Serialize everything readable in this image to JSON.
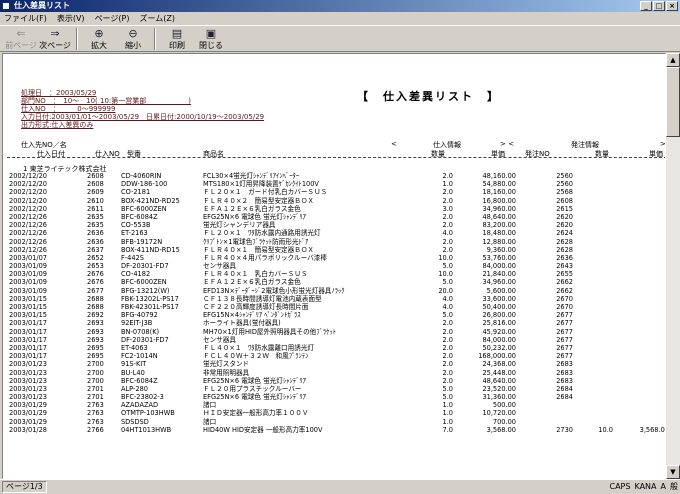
{
  "window": {
    "title": "仕入差異リスト",
    "controls": [
      "_",
      "□",
      "×"
    ]
  },
  "menu": [
    "ファイル(F)",
    "表示(V)",
    "ページ(P)",
    "ズーム(Z)"
  ],
  "toolbar": [
    {
      "label": "前ページ",
      "icon": "prev-page-icon",
      "glyph": "⇐",
      "enabled": false
    },
    {
      "label": "次ページ",
      "icon": "next-page-icon",
      "glyph": "⇒",
      "enabled": true
    },
    {
      "label": "拡大",
      "icon": "zoom-in-icon",
      "glyph": "⊕",
      "enabled": true
    },
    {
      "label": "縮小",
      "icon": "zoom-out-icon",
      "glyph": "⊖",
      "enabled": true
    },
    {
      "label": "印刷",
      "icon": "print-icon",
      "glyph": "▤",
      "enabled": true
    },
    {
      "label": "閉じる",
      "icon": "close-icon",
      "glyph": "▣",
      "enabled": true
    }
  ],
  "report": {
    "title": "【　仕入差異リスト　】",
    "header_lines": [
      "処理日　：2003/05/29",
      "部門NO　：　10～　10( 10:第一営業部　　　　　　)",
      "仕入NO　：　　　0～999999",
      "入力日付:2003/01/01～2003/05/29　日累日付:2000/10/19～2003/05/29",
      "出力形式:仕入差異のみ"
    ],
    "col_head1": {
      "supplier": "仕入先NO／名",
      "lt": "<",
      "purchase_info": "仕入情報",
      "gt_lt": "> <",
      "order_info": "発注情報",
      "gt": ">"
    },
    "col_head2": {
      "date": "仕入日付",
      "no": "仕入NO",
      "code": "型番",
      "name": "商品名",
      "qty": "数量",
      "price": "単価",
      "order_no": "発注NO",
      "order_qty": "数量",
      "order_price": "単価"
    },
    "group": "1 東芝ライテック株式会社",
    "rows": [
      [
        "2002/12/20",
        "2608",
        "CD-4060RIN",
        "FCL30×4蛍光灯ｼｬﾝﾃﾞﾘｱｲﾝﾍﾞｰﾀｰ",
        "2.0",
        "48,160.00",
        "2560",
        "",
        ""
      ],
      [
        "2002/12/20",
        "2608",
        "DDW-186-100",
        "MTS180×1灯用昇降装置ｹﾞｶﾝｸｲﾄ100V",
        "1.0",
        "54,880.00",
        "2560",
        "",
        ""
      ],
      [
        "2002/12/20",
        "2609",
        "CO-2181",
        "ＦＬ２０×１　ガード付乳白カバーＳＵＳ",
        "2.0",
        "18,160.00",
        "2568",
        "",
        ""
      ],
      [
        "2002/12/20",
        "2610",
        "BOX-421ND-RD25",
        "ＦＬＲ４０×２　簡易型安定器ＢＯＸ",
        "2.0",
        "16,800.00",
        "2608",
        "",
        ""
      ],
      [
        "2002/12/20",
        "2611",
        "BFC-6000ZEN",
        "ＥＦＡ１２Ｅ×６乳白ガラス金色",
        "3.0",
        "34,960.00",
        "2615",
        "",
        ""
      ],
      [
        "2002/12/26",
        "2635",
        "BFC-6084Z",
        "EFG25N×6 電球色 蛍光灯ｼｬﾝﾃﾞﾘｱ",
        "2.0",
        "48,640.00",
        "2620",
        "",
        ""
      ],
      [
        "2002/12/26",
        "2635",
        "CO-553B",
        "蛍光灯シャンデリア器具",
        "2.0",
        "83,200.00",
        "2620",
        "",
        ""
      ],
      [
        "2002/12/26",
        "2636",
        "ET-2163",
        "ＦＬ２０×１　ﾜﾀ防水露内通路用誘光灯",
        "4.0",
        "18,480.00",
        "2624",
        "",
        ""
      ],
      [
        "2002/12/26",
        "2636",
        "BFB-19172N",
        "ｸﾘﾌﾟﾄﾝ×1電球色ﾌﾞﾗｹｯﾄ防雨形光ﾄﾞｱ",
        "2.0",
        "12,880.00",
        "2628",
        "",
        ""
      ],
      [
        "2002/12/26",
        "2637",
        "BOX-411ND-RD15",
        "ＦＬＲ４０×１　簡易型安定器ＢＯＸ",
        "2.0",
        "9,360.00",
        "2628",
        "",
        ""
      ],
      [
        "2003/01/07",
        "2652",
        "F-442S",
        "ＦＬＲ４０×４用パラボリックルーバ漆棒",
        "10.0",
        "53,760.00",
        "2636",
        "",
        ""
      ],
      [
        "2003/01/09",
        "2653",
        "DF-20301-FD7",
        "センサ器具",
        "5.0",
        "84,000.00",
        "2643",
        "",
        ""
      ],
      [
        "2003/01/09",
        "2676",
        "CO-4182",
        "ＦＬＲ４０×１　乳白カバーＳＵＳ",
        "10.0",
        "21,840.00",
        "2655",
        "",
        ""
      ],
      [
        "2003/01/09",
        "2676",
        "BFC-6000ZEN",
        "ＥＦＡ１２Ｅ×６乳白ガラス金色",
        "5.0",
        "34,960.00",
        "2662",
        "",
        ""
      ],
      [
        "2003/01/09",
        "2677",
        "BFG-13212(W)",
        "EFD13N×ﾃﾞｰﾀﾞｰｼﾞ2電球色小形蛍光灯器具ﾉﾗｯｸ",
        "20.0",
        "5,600.00",
        "2662",
        "",
        ""
      ],
      [
        "2003/01/15",
        "2688",
        "FBK-13202L-PS17",
        "ＣＦ１３８長時間誘導灯電池内蔵表面型",
        "4.0",
        "33,600.00",
        "2670",
        "",
        ""
      ],
      [
        "2003/01/15",
        "2688",
        "FBK-42301L-PS17",
        "ＣＦ２２０高輝度誘導灯長時間片面",
        "4.0",
        "50,400.00",
        "2670",
        "",
        ""
      ],
      [
        "2003/01/15",
        "2692",
        "BFG-40792",
        "EFG15N×4ｼｬﾝﾃﾞﾘｱ ﾍﾟﾝﾀﾞﾝﾄｶﾞﾗｽ",
        "5.0",
        "26,800.00",
        "2677",
        "",
        ""
      ],
      [
        "2003/01/17",
        "2693",
        "92EIT-J3B",
        "ホーライト器具(蛍付器具)",
        "2.0",
        "25,816.00",
        "2677",
        "",
        ""
      ],
      [
        "2003/01/17",
        "2693",
        "BN-0708(K)",
        "MH70×1灯用HID屋外照明器具その他ﾌﾞﾗｹｯﾄ",
        "2.0",
        "45,920.00",
        "2677",
        "",
        ""
      ],
      [
        "2003/01/17",
        "2693",
        "DF-20301-FD7",
        "センサ器具",
        "2.0",
        "84,000.00",
        "2677",
        "",
        ""
      ],
      [
        "2003/01/17",
        "2695",
        "ET-4063",
        "ＦＬ４０×１　ﾜﾀ防水露離口用誘光灯",
        "2.0",
        "50,232.00",
        "2677",
        "",
        ""
      ],
      [
        "2003/01/17",
        "2695",
        "FC2-1014N",
        "ＦＣＬ４０Ｗ＋３２Ｗ　和風ﾌﾟﾗﾝﾃﾝ",
        "2.0",
        "168,000.00",
        "2677",
        "",
        ""
      ],
      [
        "2003/01/23",
        "2700",
        "91S-KIT",
        "蛍光灯スタンド",
        "2.0",
        "24,368.00",
        "2683",
        "",
        ""
      ],
      [
        "2003/01/23",
        "2700",
        "BU-L40",
        "非常用照明器具",
        "2.0",
        "25,448.00",
        "2683",
        "",
        ""
      ],
      [
        "2003/01/23",
        "2700",
        "BFC-6084Z",
        "EFG25N×6 電球色 蛍光灯ｼｬﾝﾃﾞﾘｱ",
        "2.0",
        "48,640.00",
        "2683",
        "",
        ""
      ],
      [
        "2003/01/23",
        "2701",
        "ALP-280",
        "ＦＬ２０用プラスチックルーバー",
        "5.0",
        "23,520.00",
        "2684",
        "",
        ""
      ],
      [
        "2003/01/23",
        "2701",
        "BFC-23802-3",
        "EFG25N×6 電球色 蛍光灯ｼｬﾝﾃﾞﾘｱ",
        "5.0",
        "31,360.00",
        "2684",
        "",
        ""
      ],
      [
        "2003/01/29",
        "2763",
        "AZADAZAD",
        "諸口",
        "1.0",
        "500.00",
        "",
        "",
        ""
      ],
      [
        "2003/01/29",
        "2763",
        "OTMTP-103HWB",
        "ＨＩＤ安定器一般形高力率１００Ｖ",
        "1.0",
        "10,720.00",
        "",
        "",
        ""
      ],
      [
        "2003/01/29",
        "2763",
        "SDSDSD",
        "諸口",
        "1.0",
        "700.00",
        "",
        "",
        ""
      ],
      [
        "2003/01/28",
        "2766",
        "04HT1013HWB",
        "HID40W HID安定器 一般形高力率100V",
        "7.0",
        "3,568.00",
        "2730",
        "10.0",
        "3,568.00"
      ]
    ]
  },
  "status": {
    "page": "ページ1/3",
    "tray": [
      "CAPS",
      "KANA",
      "A",
      "般"
    ]
  }
}
